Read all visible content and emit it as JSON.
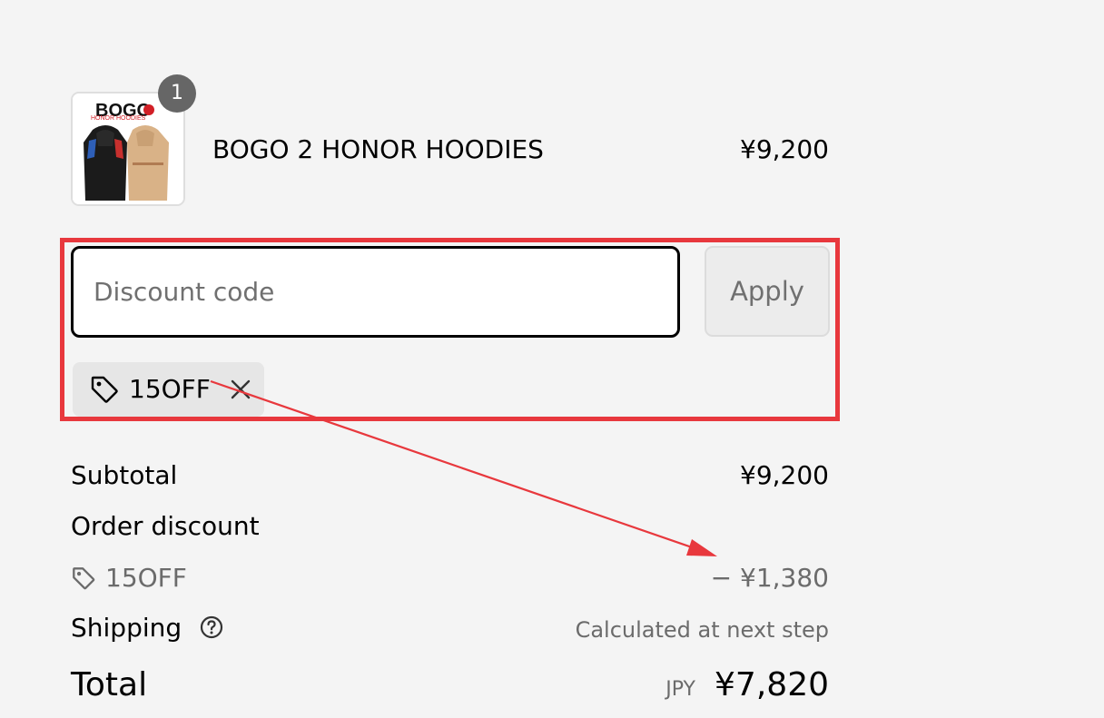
{
  "product": {
    "name": "BOGO 2 HONOR HOODIES",
    "price": "¥9,200",
    "quantity": "1",
    "image_text": "BOGO",
    "image_subtext": "HONOR HOODIES"
  },
  "discount": {
    "placeholder": "Discount code",
    "apply_label": "Apply",
    "applied_code": "15OFF"
  },
  "summary": {
    "subtotal_label": "Subtotal",
    "subtotal_value": "¥9,200",
    "order_discount_label": "Order discount",
    "discount_code": "15OFF",
    "discount_value": "− ¥1,380",
    "shipping_label": "Shipping",
    "shipping_value": "Calculated at next step",
    "total_label": "Total",
    "currency": "JPY",
    "total_value": "¥7,820"
  },
  "icons": {
    "tag": "tag-icon",
    "close": "close-icon",
    "help": "help-circle-icon"
  },
  "colors": {
    "highlight": "#e8383d",
    "background": "#f4f4f4",
    "muted_text": "#6b6b6b"
  }
}
